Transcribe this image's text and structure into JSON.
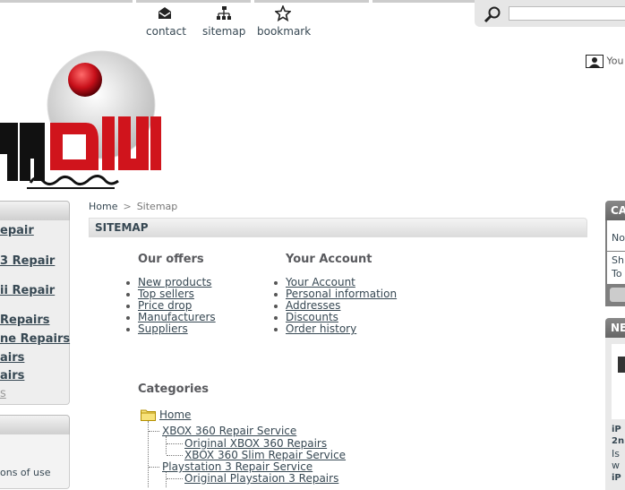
{
  "header": {
    "links": [
      {
        "label": "contact",
        "icon": "envelope-icon"
      },
      {
        "label": "sitemap",
        "icon": "sitemap-icon"
      },
      {
        "label": "bookmark",
        "icon": "star-icon"
      }
    ],
    "user_info": "You"
  },
  "left_column": {
    "categories": [
      "epair",
      "3 Repair",
      "ii Repair",
      "Repairs",
      "ne Repairs",
      "airs",
      "airs",
      "s"
    ],
    "info_text": "ons of use"
  },
  "breadcrumb": {
    "home": "Home",
    "separator": ">",
    "current": "Sitemap"
  },
  "page_title": "SITEMAP",
  "our_offers": {
    "title": "Our offers",
    "items": [
      "New products",
      "Top sellers",
      "Price drop",
      "Manufacturers",
      "Suppliers"
    ]
  },
  "your_account": {
    "title": "Your Account",
    "items": [
      "Your Account",
      "Personal information",
      "Addresses",
      "Discounts",
      "Order history"
    ]
  },
  "categories": {
    "title": "Categories",
    "home": "Home",
    "tree": [
      {
        "label": "XBOX 360 Repair Service",
        "children": [
          "Original XBOX 360 Repairs",
          "XBOX 360 Slim Repair Service"
        ]
      },
      {
        "label": "Playstation 3 Repair Service",
        "children": [
          "Original Playstaion 3 Repairs"
        ]
      }
    ]
  },
  "right_column": {
    "cart_head": "CA",
    "cart_lines": [
      "No",
      "Sh",
      "To"
    ],
    "news_head": "NE",
    "news_lines": [
      "iP",
      "2n",
      "Is",
      "w",
      "iP"
    ]
  },
  "colors": {
    "accent_red": "#d0141c",
    "text": "#374853",
    "logo_black": "#111111"
  }
}
